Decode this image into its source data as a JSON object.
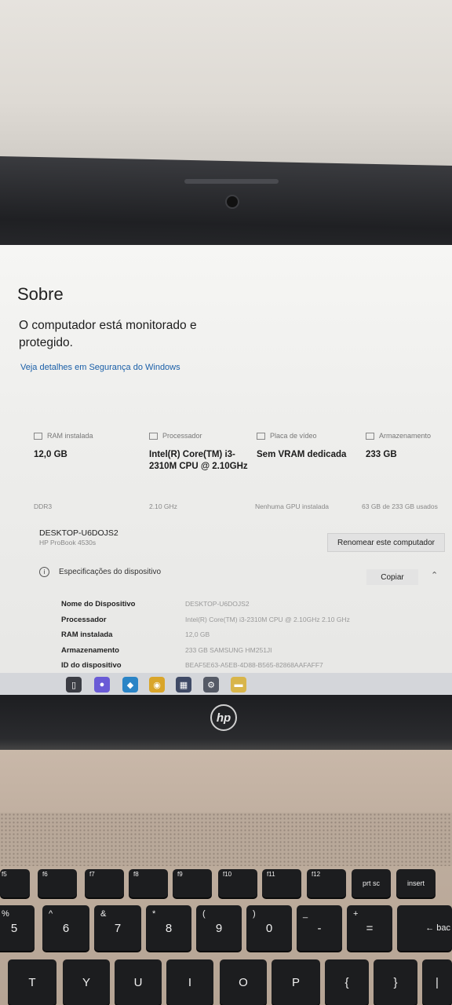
{
  "about": {
    "title": "Sobre",
    "protection_message": "O computador está monitorado e protegido.",
    "security_link": "Veja detalhes em Segurança do Windows"
  },
  "spec_cards": [
    {
      "label": "RAM instalada",
      "value": "12,0 GB",
      "detail": "DDR3",
      "icon": "ram-icon"
    },
    {
      "label": "Processador",
      "value": "Intel(R) Core(TM) i3-2310M CPU @ 2.10GHz",
      "detail": "2.10 GHz",
      "icon": "cpu-icon"
    },
    {
      "label": "Placa de vídeo",
      "value": "Sem VRAM dedicada",
      "detail": "Nenhuma GPU instalada",
      "icon": "gpu-icon"
    },
    {
      "label": "Armazenamento",
      "value": "233 GB",
      "detail": "63 GB de 233 GB usados",
      "icon": "storage-icon"
    }
  ],
  "device": {
    "name": "DESKTOP-U6DOJS2",
    "model": "HP ProBook 4530s",
    "rename_button": "Renomear este computador"
  },
  "device_specs": {
    "heading": "Especificações do dispositivo",
    "copy_button": "Copiar",
    "rows": [
      {
        "key": "Nome do Dispositivo",
        "value": "DESKTOP-U6DOJS2"
      },
      {
        "key": "Processador",
        "value": "Intel(R) Core(TM) i3-2310M CPU @ 2.10GHz   2.10 GHz"
      },
      {
        "key": "RAM instalada",
        "value": "12,0 GB"
      },
      {
        "key": "Armazenamento",
        "value": "233 GB SAMSUNG HM251JI"
      },
      {
        "key": "ID do dispositivo",
        "value": "BEAF5E63-A5EB-4D88-B565-82868AAFAFF7"
      }
    ]
  },
  "taskbar": {
    "icons": [
      {
        "name": "task-view-icon",
        "glyph": "▯",
        "color": "#3b3d44"
      },
      {
        "name": "copilot-icon",
        "glyph": "●",
        "color": "#6a5bd6"
      },
      {
        "name": "store-icon",
        "glyph": "◆",
        "color": "#2a84c6"
      },
      {
        "name": "chrome-icon",
        "glyph": "◉",
        "color": "#d9a52a"
      },
      {
        "name": "calculator-icon",
        "glyph": "▦",
        "color": "#3f4a66"
      },
      {
        "name": "settings-icon",
        "glyph": "⚙",
        "color": "#555a66"
      },
      {
        "name": "file-explorer-icon",
        "glyph": "▬",
        "color": "#d8b54a"
      }
    ]
  },
  "laptop": {
    "brand": "hp"
  },
  "keyboard": {
    "fn_row": [
      "f5",
      "f6",
      "f7",
      "f8",
      "f9",
      "f10",
      "f11",
      "f12",
      "prt sc",
      "insert"
    ],
    "number_row": [
      {
        "top": "%",
        "main": "5"
      },
      {
        "top": "^",
        "main": "6"
      },
      {
        "top": "&",
        "main": "7"
      },
      {
        "top": "*",
        "main": "8"
      },
      {
        "top": "(",
        "main": "9"
      },
      {
        "top": ")",
        "main": "0"
      },
      {
        "top": "_",
        "main": "-"
      },
      {
        "top": "+",
        "main": "="
      }
    ],
    "backspace": "← bac",
    "letter_row": [
      "T",
      "Y",
      "U",
      "I",
      "O",
      "P",
      "{",
      "}",
      "|"
    ]
  }
}
